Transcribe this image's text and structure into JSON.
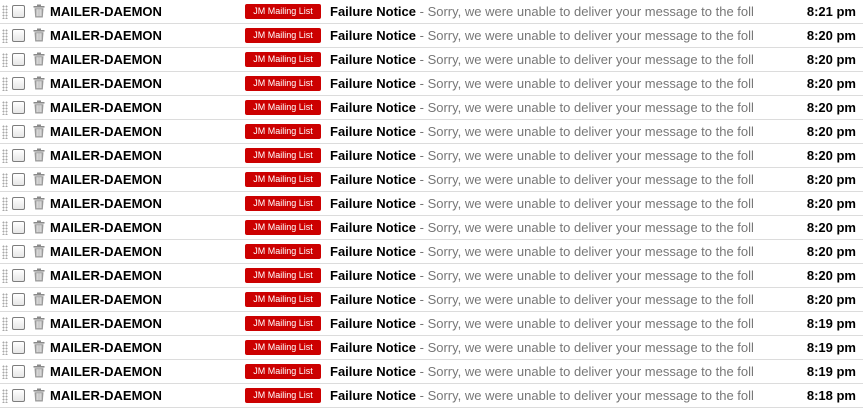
{
  "emails": [
    {
      "sender": "MAILER-DAEMON",
      "label": "JM Mailing List",
      "subject": "Failure Notice",
      "separator": "-",
      "snippet": "Sorry, we were unable to deliver your message to the foll",
      "time": "8:21 pm"
    },
    {
      "sender": "MAILER-DAEMON",
      "label": "JM Mailing List",
      "subject": "Failure Notice",
      "separator": "-",
      "snippet": "Sorry, we were unable to deliver your message to the foll",
      "time": "8:20 pm"
    },
    {
      "sender": "MAILER-DAEMON",
      "label": "JM Mailing List",
      "subject": "Failure Notice",
      "separator": "-",
      "snippet": "Sorry, we were unable to deliver your message to the foll",
      "time": "8:20 pm"
    },
    {
      "sender": "MAILER-DAEMON",
      "label": "JM Mailing List",
      "subject": "Failure Notice",
      "separator": "-",
      "snippet": "Sorry, we were unable to deliver your message to the foll",
      "time": "8:20 pm"
    },
    {
      "sender": "MAILER-DAEMON",
      "label": "JM Mailing List",
      "subject": "Failure Notice",
      "separator": "-",
      "snippet": "Sorry, we were unable to deliver your message to the foll",
      "time": "8:20 pm"
    },
    {
      "sender": "MAILER-DAEMON",
      "label": "JM Mailing List",
      "subject": "Failure Notice",
      "separator": "-",
      "snippet": "Sorry, we were unable to deliver your message to the foll",
      "time": "8:20 pm"
    },
    {
      "sender": "MAILER-DAEMON",
      "label": "JM Mailing List",
      "subject": "Failure Notice",
      "separator": "-",
      "snippet": "Sorry, we were unable to deliver your message to the foll",
      "time": "8:20 pm"
    },
    {
      "sender": "MAILER-DAEMON",
      "label": "JM Mailing List",
      "subject": "Failure Notice",
      "separator": "-",
      "snippet": "Sorry, we were unable to deliver your message to the foll",
      "time": "8:20 pm"
    },
    {
      "sender": "MAILER-DAEMON",
      "label": "JM Mailing List",
      "subject": "Failure Notice",
      "separator": "-",
      "snippet": "Sorry, we were unable to deliver your message to the foll",
      "time": "8:20 pm"
    },
    {
      "sender": "MAILER-DAEMON",
      "label": "JM Mailing List",
      "subject": "Failure Notice",
      "separator": "-",
      "snippet": "Sorry, we were unable to deliver your message to the foll",
      "time": "8:20 pm"
    },
    {
      "sender": "MAILER-DAEMON",
      "label": "JM Mailing List",
      "subject": "Failure Notice",
      "separator": "-",
      "snippet": "Sorry, we were unable to deliver your message to the foll",
      "time": "8:20 pm"
    },
    {
      "sender": "MAILER-DAEMON",
      "label": "JM Mailing List",
      "subject": "Failure Notice",
      "separator": "-",
      "snippet": "Sorry, we were unable to deliver your message to the foll",
      "time": "8:20 pm"
    },
    {
      "sender": "MAILER-DAEMON",
      "label": "JM Mailing List",
      "subject": "Failure Notice",
      "separator": "-",
      "snippet": "Sorry, we were unable to deliver your message to the foll",
      "time": "8:20 pm"
    },
    {
      "sender": "MAILER-DAEMON",
      "label": "JM Mailing List",
      "subject": "Failure Notice",
      "separator": "-",
      "snippet": "Sorry, we were unable to deliver your message to the foll",
      "time": "8:19 pm"
    },
    {
      "sender": "MAILER-DAEMON",
      "label": "JM Mailing List",
      "subject": "Failure Notice",
      "separator": "-",
      "snippet": "Sorry, we were unable to deliver your message to the foll",
      "time": "8:19 pm"
    },
    {
      "sender": "MAILER-DAEMON",
      "label": "JM Mailing List",
      "subject": "Failure Notice",
      "separator": "-",
      "snippet": "Sorry, we were unable to deliver your message to the foll",
      "time": "8:19 pm"
    },
    {
      "sender": "MAILER-DAEMON",
      "label": "JM Mailing List",
      "subject": "Failure Notice",
      "separator": "-",
      "snippet": "Sorry, we were unable to deliver your message to the foll",
      "time": "8:18 pm"
    }
  ],
  "icons": {
    "drag": "drag-handle-icon",
    "select": "checkbox",
    "delete": "trash-icon"
  },
  "colors": {
    "label_bg": "#cc0000",
    "label_text": "#ffffff",
    "snippet": "#777777",
    "divider": "#dcdcdc"
  }
}
